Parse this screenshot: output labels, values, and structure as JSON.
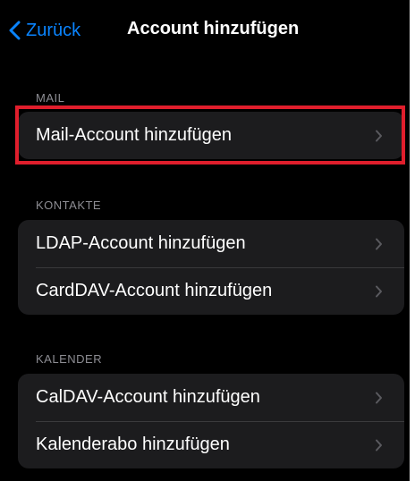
{
  "navbar": {
    "back_label": "Zurück",
    "title": "Account hinzufügen"
  },
  "sections": [
    {
      "header": "MAIL",
      "items": [
        {
          "label": "Mail-Account hinzufügen"
        }
      ]
    },
    {
      "header": "KONTAKTE",
      "items": [
        {
          "label": "LDAP-Account hinzufügen"
        },
        {
          "label": "CardDAV-Account hinzufügen"
        }
      ]
    },
    {
      "header": "KALENDER",
      "items": [
        {
          "label": "CalDAV-Account hinzufügen"
        },
        {
          "label": "Kalenderabo hinzufügen"
        }
      ]
    }
  ],
  "icons": {
    "back": "chevron-left-icon",
    "disclosure": "chevron-right-icon"
  },
  "colors": {
    "background": "#000000",
    "group_background": "#1c1c1e",
    "accent": "#0a84ff",
    "section_header": "#8d8d93",
    "highlight_border": "#e01e2c"
  }
}
